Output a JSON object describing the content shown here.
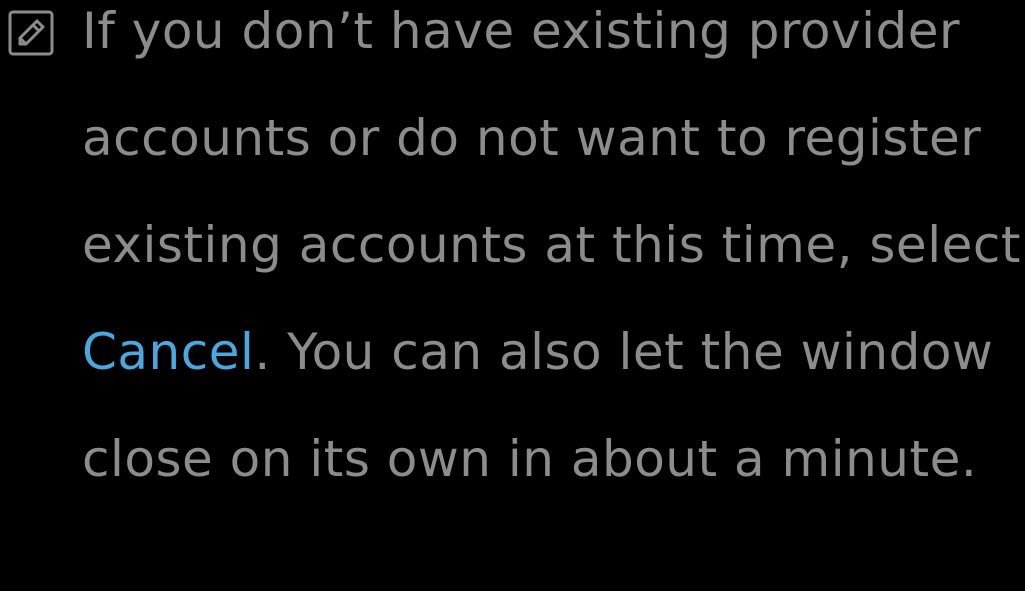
{
  "note": {
    "icon": "note-pencil-icon",
    "text_before": "If you don’t have existing provider accounts or do not want to register existing accounts at this time, select ",
    "highlight": "Cancel",
    "text_after": ". You can also let the window close on its own in about a minute."
  },
  "colors": {
    "background": "#000000",
    "text": "#8c8c8c",
    "highlight": "#4aa8e0"
  }
}
